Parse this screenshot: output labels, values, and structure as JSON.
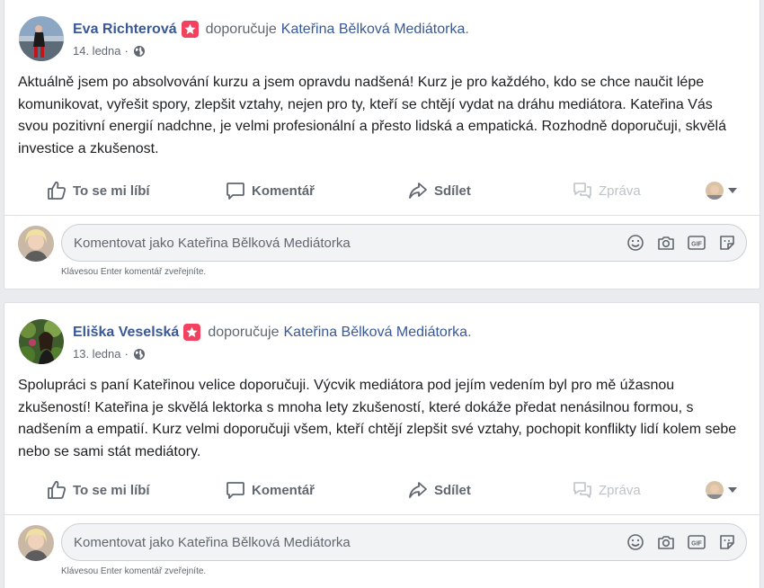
{
  "posts": [
    {
      "author": "Eva Richterová",
      "verb": "doporučuje",
      "page": "Kateřina Bělková Mediátorka",
      "trail": ".",
      "date": "14. ledna",
      "sep": "·",
      "text": "Aktuálně jsem po absolvování kurzu a jsem opravdu nadšená! Kurz je pro každého, kdo se chce naučit lépe komunikovat, vyřešit spory, zlepšit vztahy, nejen pro ty, kteří se chtějí vydat na dráhu mediátora. Kateřina Vás svou pozitivní energií nadchne, je velmi profesionální a přesto lidská a empatická. Rozhodně doporučuji, skvělá investice a zkušenost."
    },
    {
      "author": "Eliška Veselská",
      "verb": "doporučuje",
      "page": "Kateřina Bělková Mediátorka",
      "trail": ".",
      "date": "13. ledna",
      "sep": "·",
      "text": "Spolupráci s paní Kateřinou velice doporučuji. Výcvik mediátora pod jejím vedením byl pro mě úžasnou zkušeností! Kateřina je skvělá lektorka s mnoha lety zkušeností, které dokáže předat nenásilnou formou, s nadšením a empatií. Kurz velmi doporučuji všem, kteří chtějí zlepšit své vztahy, pochopit konflikty lidí kolem sebe nebo se sami stát mediátory."
    }
  ],
  "actions": {
    "like": "To se mi líbí",
    "comment": "Komentář",
    "share": "Sdílet",
    "message": "Zpráva"
  },
  "composer": {
    "placeholder": "Komentovat jako Kateřina Bělková Mediátorka",
    "hint": "Klávesou Enter komentář zveřejníte."
  },
  "icons": {
    "recommend": "star-badge-icon",
    "privacy": "globe-icon",
    "like": "thumbs-up-icon",
    "comment": "speech-bubble-icon",
    "share": "share-arrow-icon",
    "message": "chat-bubbles-icon",
    "emoji": "smiley-icon",
    "photo": "camera-icon",
    "gif": "gif-icon",
    "sticker": "sticker-icon"
  },
  "colors": {
    "link": "#385898",
    "badge": "#f3425f",
    "muted": "#606770",
    "disabled": "#bec3c9"
  }
}
